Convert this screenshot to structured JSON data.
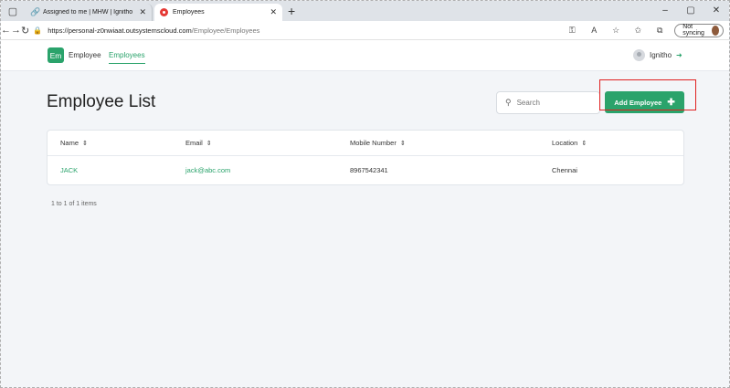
{
  "browser": {
    "tabs": [
      {
        "label": "Assigned to me | MHW | Ignitho",
        "active": false,
        "icon": "link-icon"
      },
      {
        "label": "Employees",
        "active": true,
        "icon": "outsystems-icon"
      }
    ],
    "url_host": "https://personal-z0nwiaat.outsystemscloud.com",
    "url_path": "/Employee/Employees",
    "sync_label": "Not syncing",
    "window_controls": [
      "–",
      "▢",
      "✕"
    ]
  },
  "app": {
    "logo_text": "Em",
    "nav": {
      "employee": "Employee",
      "employees": "Employees"
    },
    "user_name": "Ignitho"
  },
  "page": {
    "title": "Employee List",
    "search_placeholder": "Search",
    "add_button_label": "Add Employee",
    "columns": [
      "Name",
      "Email",
      "Mobile Number",
      "Location"
    ],
    "rows": [
      {
        "name": "JACK",
        "email": "jack@abc.com",
        "mobile": "8967542341",
        "location": "Chennai"
      }
    ],
    "count_text": "1 to 1 of 1 items"
  },
  "colors": {
    "accent": "#2aa36b",
    "highlight_box": "#e02020"
  }
}
